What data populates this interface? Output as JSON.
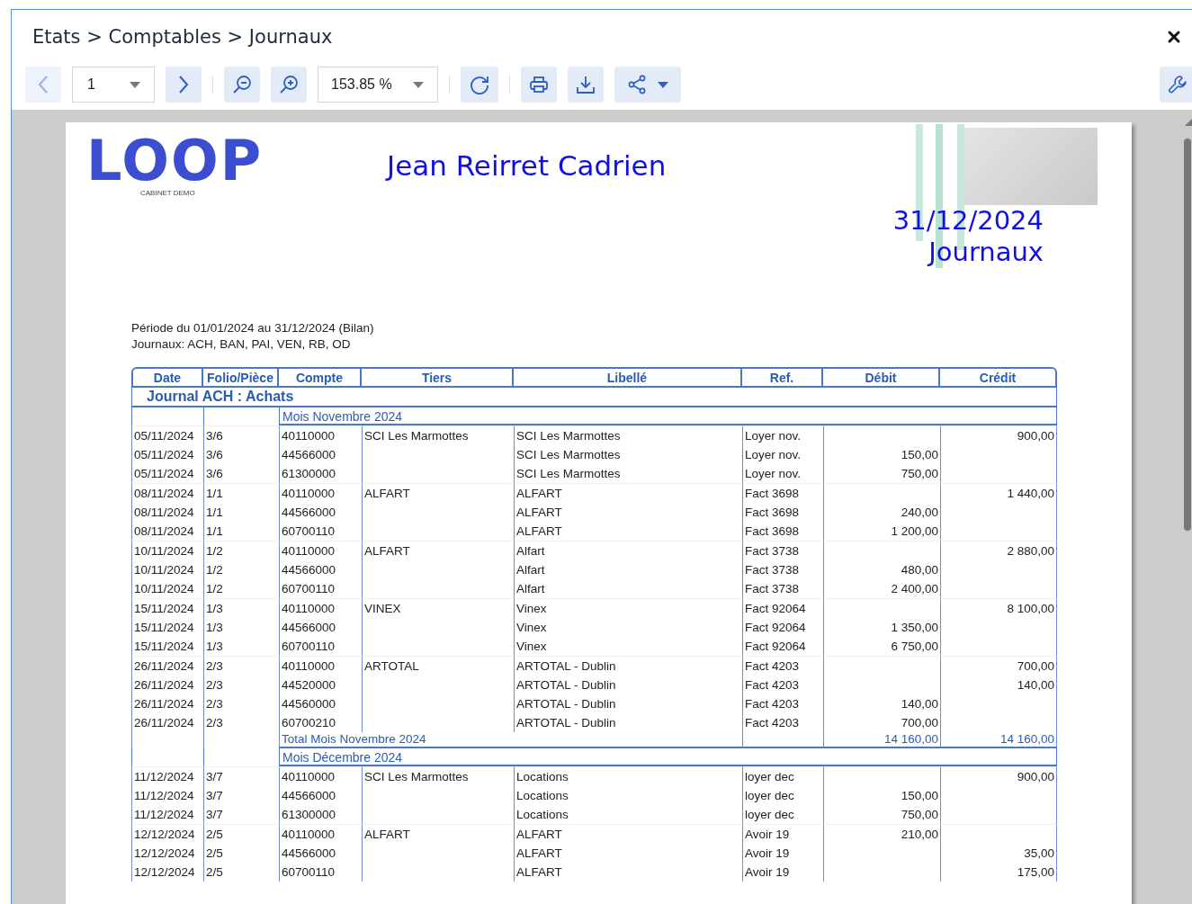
{
  "window": {
    "title": "Etats > Comptables > Journaux"
  },
  "toolbar": {
    "prev_button": {
      "disabled": true
    },
    "page_select": {
      "value": "1"
    },
    "next_button": {
      "disabled": false
    },
    "zoom_select": {
      "value": "153.85 %"
    }
  },
  "report": {
    "logo": {
      "text": "LOOP",
      "subtitle": "CABINET DEMO"
    },
    "client_name": "Jean Reirret Cadrien",
    "date": "31/12/2024",
    "title": "Journaux",
    "period": "Période du 01/01/2024 au 31/12/2024 (Bilan)",
    "journals": "Journaux: ACH, BAN, PAI, VEN, RB, OD",
    "table": {
      "columns": [
        "Date",
        "Folio/Pièce",
        "Compte",
        "Tiers",
        "Libellé",
        "Ref.",
        "Débit",
        "Crédit"
      ],
      "journal_title": "Journal ACH : Achats",
      "sections": [
        {
          "heading": "Mois Novembre 2024",
          "groups": [
            [
              {
                "date": "05/11/2024",
                "folio": "3/6",
                "compte": "40110000",
                "tiers": "SCI Les Marmottes",
                "libelle": "SCI Les Marmottes",
                "ref": "Loyer nov.",
                "credit": "900,00"
              },
              {
                "date": "05/11/2024",
                "folio": "3/6",
                "compte": "44566000",
                "libelle": "SCI Les Marmottes",
                "ref": "Loyer nov.",
                "debit": "150,00"
              },
              {
                "date": "05/11/2024",
                "folio": "3/6",
                "compte": "61300000",
                "libelle": "SCI Les Marmottes",
                "ref": "Loyer nov.",
                "debit": "750,00"
              }
            ],
            [
              {
                "date": "08/11/2024",
                "folio": "1/1",
                "compte": "40110000",
                "tiers": "ALFART",
                "libelle": "ALFART",
                "ref": "Fact 3698",
                "credit": "1 440,00"
              },
              {
                "date": "08/11/2024",
                "folio": "1/1",
                "compte": "44566000",
                "libelle": "ALFART",
                "ref": "Fact 3698",
                "debit": "240,00"
              },
              {
                "date": "08/11/2024",
                "folio": "1/1",
                "compte": "60700110",
                "libelle": "ALFART",
                "ref": "Fact 3698",
                "debit": "1 200,00"
              }
            ],
            [
              {
                "date": "10/11/2024",
                "folio": "1/2",
                "compte": "40110000",
                "tiers": "ALFART",
                "libelle": "Alfart",
                "ref": "Fact 3738",
                "credit": "2 880,00"
              },
              {
                "date": "10/11/2024",
                "folio": "1/2",
                "compte": "44566000",
                "libelle": "Alfart",
                "ref": "Fact 3738",
                "debit": "480,00"
              },
              {
                "date": "10/11/2024",
                "folio": "1/2",
                "compte": "60700110",
                "libelle": "Alfart",
                "ref": "Fact 3738",
                "debit": "2 400,00"
              }
            ],
            [
              {
                "date": "15/11/2024",
                "folio": "1/3",
                "compte": "40110000",
                "tiers": "VINEX",
                "libelle": "Vinex",
                "ref": "Fact 92064",
                "credit": "8 100,00"
              },
              {
                "date": "15/11/2024",
                "folio": "1/3",
                "compte": "44566000",
                "libelle": "Vinex",
                "ref": "Fact 92064",
                "debit": "1 350,00"
              },
              {
                "date": "15/11/2024",
                "folio": "1/3",
                "compte": "60700110",
                "libelle": "Vinex",
                "ref": "Fact 92064",
                "debit": "6 750,00"
              }
            ],
            [
              {
                "date": "26/11/2024",
                "folio": "2/3",
                "compte": "40110000",
                "tiers": "ARTOTAL",
                "libelle": "ARTOTAL - Dublin",
                "ref": "Fact 4203",
                "credit": "700,00"
              },
              {
                "date": "26/11/2024",
                "folio": "2/3",
                "compte": "44520000",
                "libelle": "ARTOTAL - Dublin",
                "ref": "Fact 4203",
                "credit": "140,00"
              },
              {
                "date": "26/11/2024",
                "folio": "2/3",
                "compte": "44560000",
                "libelle": "ARTOTAL - Dublin",
                "ref": "Fact 4203",
                "debit": "140,00"
              },
              {
                "date": "26/11/2024",
                "folio": "2/3",
                "compte": "60700210",
                "libelle": "ARTOTAL - Dublin",
                "ref": "Fact 4203",
                "debit": "700,00"
              }
            ]
          ],
          "total": {
            "label": "Total Mois Novembre 2024",
            "debit": "14 160,00",
            "credit": "14 160,00"
          }
        },
        {
          "heading": "Mois Décembre 2024",
          "groups": [
            [
              {
                "date": "11/12/2024",
                "folio": "3/7",
                "compte": "40110000",
                "tiers": "SCI Les Marmottes",
                "libelle": "Locations",
                "ref": "loyer dec",
                "credit": "900,00"
              },
              {
                "date": "11/12/2024",
                "folio": "3/7",
                "compte": "44566000",
                "libelle": "Locations",
                "ref": "loyer dec",
                "debit": "150,00"
              },
              {
                "date": "11/12/2024",
                "folio": "3/7",
                "compte": "61300000",
                "libelle": "Locations",
                "ref": "loyer dec",
                "debit": "750,00"
              }
            ],
            [
              {
                "date": "12/12/2024",
                "folio": "2/5",
                "compte": "40110000",
                "tiers": "ALFART",
                "libelle": "ALFART",
                "ref": "Avoir 19",
                "debit": "210,00"
              },
              {
                "date": "12/12/2024",
                "folio": "2/5",
                "compte": "44566000",
                "libelle": "ALFART",
                "ref": "Avoir 19",
                "credit": "35,00"
              },
              {
                "date": "12/12/2024",
                "folio": "2/5",
                "compte": "60700110",
                "libelle": "ALFART",
                "ref": "Avoir 19",
                "credit": "175,00"
              }
            ]
          ]
        }
      ]
    }
  }
}
